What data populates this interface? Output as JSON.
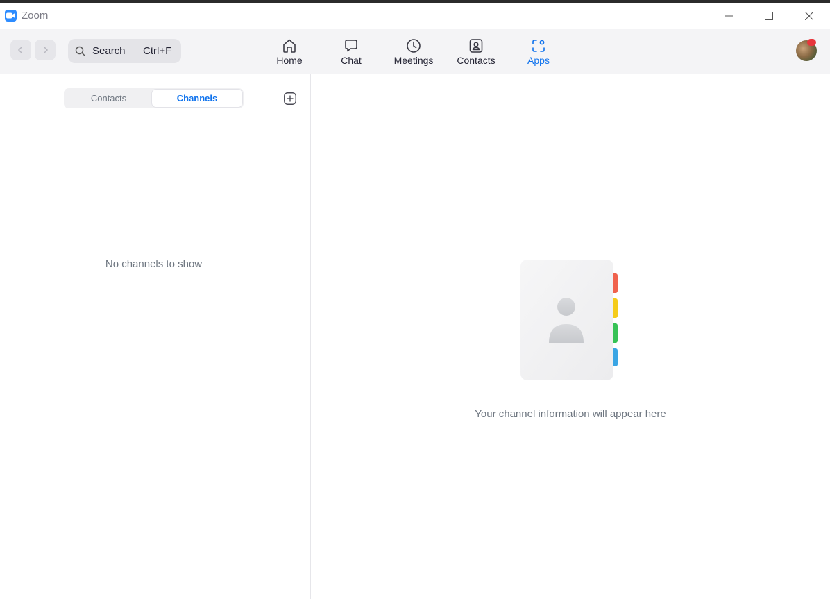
{
  "window": {
    "title": "Zoom"
  },
  "toolbar": {
    "search_label": "Search",
    "search_shortcut": "Ctrl+F",
    "tabs": [
      {
        "label": "Home",
        "icon": "home-icon"
      },
      {
        "label": "Chat",
        "icon": "chat-icon"
      },
      {
        "label": "Meetings",
        "icon": "clock-icon"
      },
      {
        "label": "Contacts",
        "icon": "contacts-icon"
      },
      {
        "label": "Apps",
        "icon": "apps-icon",
        "active": true
      }
    ],
    "accent_color": "#0e72ed"
  },
  "left_panel": {
    "segments": [
      {
        "label": "Contacts"
      },
      {
        "label": "Channels",
        "active": true
      }
    ],
    "empty_text": "No channels to show"
  },
  "right_panel": {
    "empty_text": "Your channel information will appear here",
    "illustration": "address-book-icon",
    "tab_colors": [
      "#f0624d",
      "#f5cc1a",
      "#37c256",
      "#3aa5e4"
    ]
  }
}
